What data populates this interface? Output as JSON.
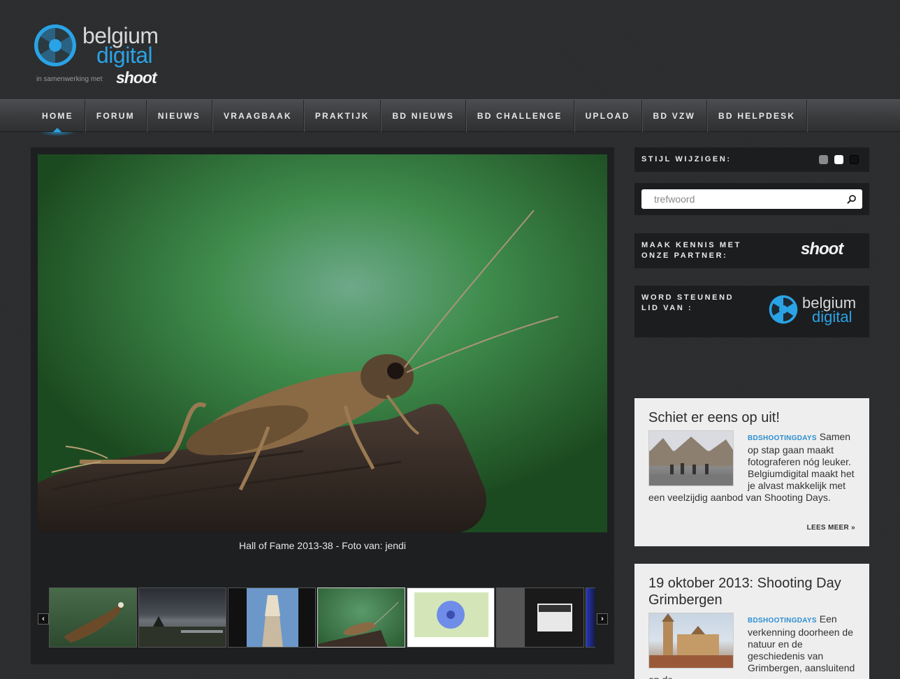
{
  "brand": {
    "word1": "belgium",
    "word2": "digital",
    "tagline": "in samenwerking met",
    "partner": "shoot",
    "accent": "#2aa3e6"
  },
  "nav": {
    "items": [
      {
        "label": "HOME",
        "active": true
      },
      {
        "label": "FORUM"
      },
      {
        "label": "NIEUWS"
      },
      {
        "label": "VRAAGBAAK"
      },
      {
        "label": "PRAKTIJK"
      },
      {
        "label": "BD NIEUWS"
      },
      {
        "label": "BD CHALLENGE"
      },
      {
        "label": "UPLOAD"
      },
      {
        "label": "BD VZW"
      },
      {
        "label": "BD HELPDESK"
      }
    ]
  },
  "slideshow": {
    "caption": "Hall of Fame 2013-38 - Foto van: jendi",
    "prev_glyph": "‹",
    "next_glyph": "›",
    "thumbnails": [
      "eagle",
      "stormy-landscape",
      "tower",
      "cricket",
      "blue-flower",
      "halt-sign",
      "blue-partial"
    ]
  },
  "sidebar": {
    "style_label": "STIJL WIJZIGEN:",
    "style_options": [
      "#8a8a8a",
      "#ffffff",
      "#111111"
    ],
    "search_placeholder": "trefwoord",
    "partner_label": "MAAK KENNIS MET ONZE PARTNER:",
    "partner_logo": "shoot",
    "member_label": "WORD STEUNEND LID VAN :",
    "member_logo_word1": "belgium",
    "member_logo_word2": "digital"
  },
  "news": [
    {
      "title": "Schiet er eens op uit!",
      "tag": "BDSHOOTINGDAYS",
      "text": "Samen op stap gaan maakt fotograferen nóg leuker. Belgiumdigital maakt het je alvast makkelijk met een veelzijdig aanbod van Shooting Days.",
      "read_more": "LEES MEER »"
    },
    {
      "title": "19 oktober 2013: Shooting Day Grimbergen",
      "tag": "BDSHOOTINGDAYS",
      "text": "Een verkenning doorheen de natuur en de geschiedenis van Grimbergen, aansluitend op de"
    }
  ]
}
